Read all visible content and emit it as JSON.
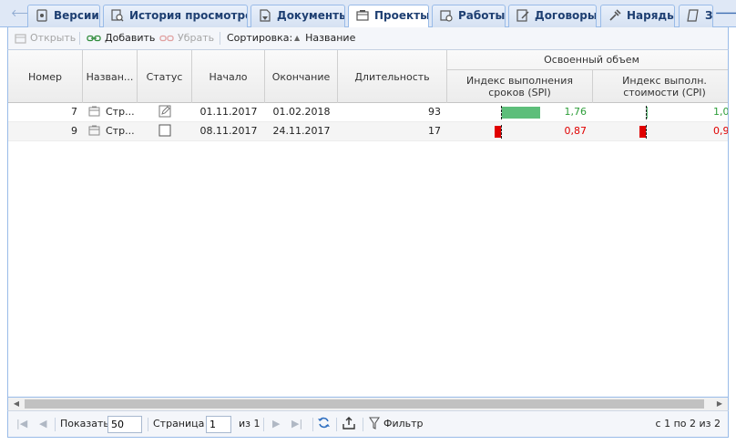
{
  "tabs": [
    {
      "label": "Версии",
      "icon": "versions-icon"
    },
    {
      "label": "История просмотров",
      "icon": "history-icon"
    },
    {
      "label": "Документы",
      "icon": "documents-icon"
    },
    {
      "label": "Проекты",
      "icon": "projects-icon",
      "active": true
    },
    {
      "label": "Работы",
      "icon": "works-icon"
    },
    {
      "label": "Договоры",
      "icon": "contracts-icon"
    },
    {
      "label": "Наряды",
      "icon": "orders-icon"
    },
    {
      "label": "З",
      "icon": "tasks-icon"
    }
  ],
  "toolbar": {
    "open_label": "Открыть",
    "add_label": "Добавить",
    "remove_label": "Убрать",
    "sort_label": "Сортировка:",
    "sort_field": "Название"
  },
  "grid": {
    "headers": {
      "number": "Номер",
      "name": "Назван...",
      "status": "Статус",
      "start": "Начало",
      "end": "Окончание",
      "duration": "Длительность",
      "earned_group": "Освоенный объем",
      "spi": "Индекс выполнения сроков (SPI)",
      "cpi": "Индекс выполн. стоимости (CPI)"
    },
    "rows": [
      {
        "number": "7",
        "name": "Стр...",
        "status": "edit",
        "start": "01.11.2017",
        "end": "01.02.2018",
        "duration": "93",
        "spi": "1,76",
        "spi_value": 1.76,
        "cpi": "1,0",
        "cpi_value": 1.0
      },
      {
        "number": "9",
        "name": "Стр...",
        "status": "empty",
        "start": "08.11.2017",
        "end": "24.11.2017",
        "duration": "17",
        "spi": "0,87",
        "spi_value": 0.87,
        "cpi": "0,9",
        "cpi_value": 0.9
      }
    ],
    "colors": {
      "positive": "#2e9e3a",
      "negative": "#e00000",
      "bar_positive": "#5dbe7a",
      "bar_negative": "#e00000"
    }
  },
  "pager": {
    "show_label": "Показать",
    "page_size": "50",
    "page_label": "Страница",
    "page_value": "1",
    "of_label": "из 1",
    "filter_label": "Фильтр",
    "summary": "с 1 по 2 из 2"
  }
}
